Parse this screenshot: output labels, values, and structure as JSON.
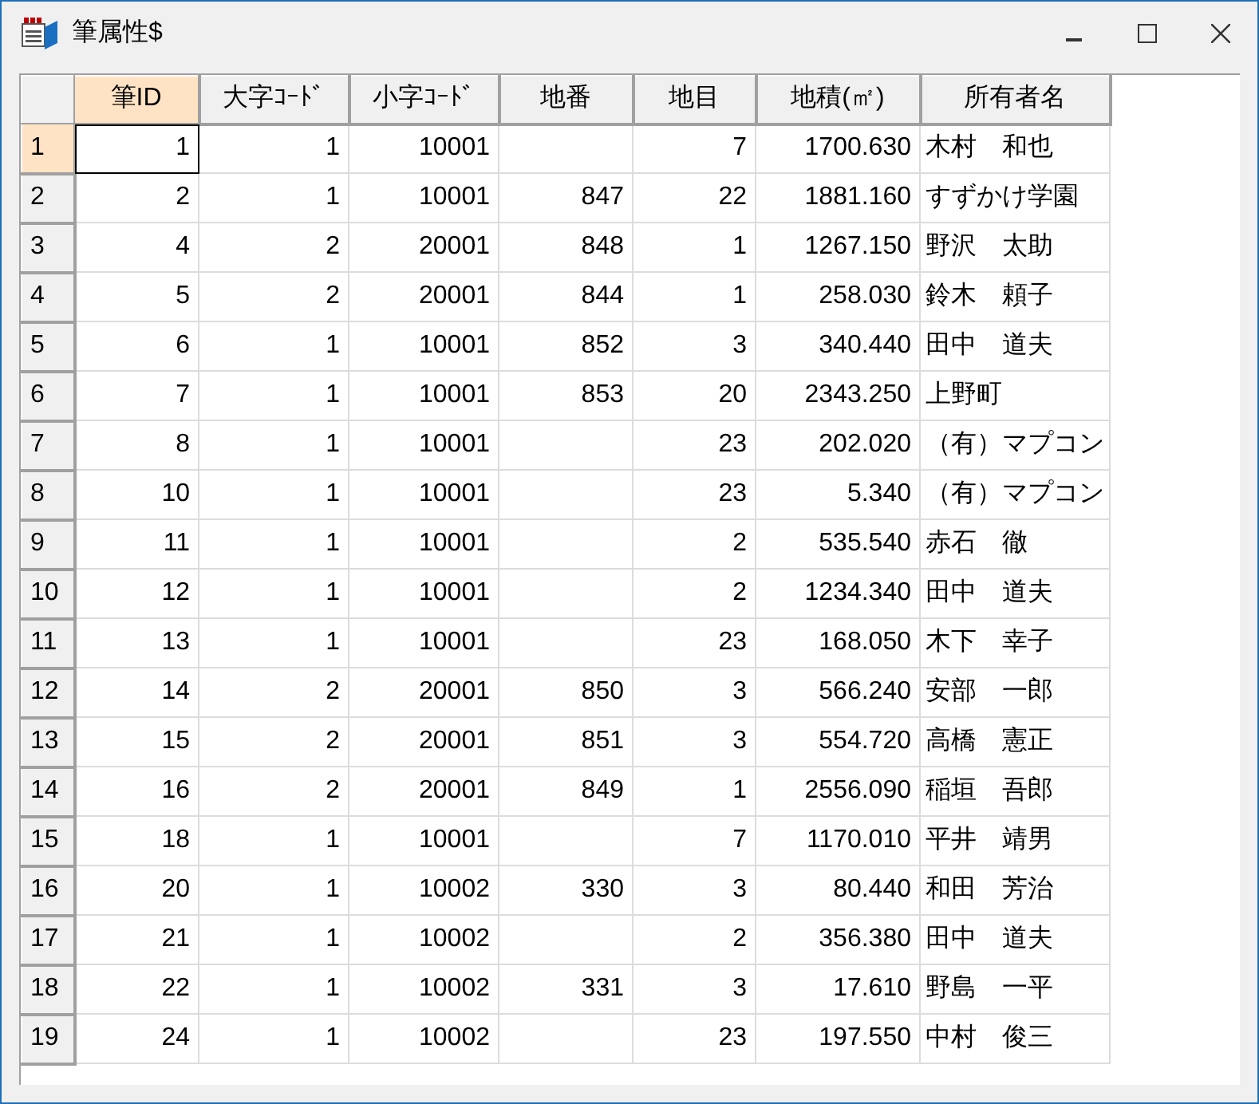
{
  "window": {
    "title": "筆属性$"
  },
  "table": {
    "columns": [
      {
        "label": "筆ID",
        "selected": true
      },
      {
        "label": "大字ｺｰﾄﾞ",
        "selected": false
      },
      {
        "label": "小字ｺｰﾄﾞ",
        "selected": false
      },
      {
        "label": "地番",
        "selected": false
      },
      {
        "label": "地目",
        "selected": false
      },
      {
        "label": "地積(㎡)",
        "selected": false
      },
      {
        "label": "所有者名",
        "selected": false
      }
    ],
    "rows": [
      {
        "number": "1",
        "selected": true,
        "cells": [
          "1",
          "1",
          "10001",
          "",
          "7",
          "1700.630",
          "木村　和也"
        ]
      },
      {
        "number": "2",
        "selected": false,
        "cells": [
          "2",
          "1",
          "10001",
          "847",
          "22",
          "1881.160",
          "すずかけ学園"
        ]
      },
      {
        "number": "3",
        "selected": false,
        "cells": [
          "4",
          "2",
          "20001",
          "848",
          "1",
          "1267.150",
          "野沢　太助"
        ]
      },
      {
        "number": "4",
        "selected": false,
        "cells": [
          "5",
          "2",
          "20001",
          "844",
          "1",
          "258.030",
          "鈴木　頼子"
        ]
      },
      {
        "number": "5",
        "selected": false,
        "cells": [
          "6",
          "1",
          "10001",
          "852",
          "3",
          "340.440",
          "田中　道夫"
        ]
      },
      {
        "number": "6",
        "selected": false,
        "cells": [
          "7",
          "1",
          "10001",
          "853",
          "20",
          "2343.250",
          "上野町"
        ]
      },
      {
        "number": "7",
        "selected": false,
        "cells": [
          "8",
          "1",
          "10001",
          "",
          "23",
          "202.020",
          "（有）マプコン"
        ]
      },
      {
        "number": "8",
        "selected": false,
        "cells": [
          "10",
          "1",
          "10001",
          "",
          "23",
          "5.340",
          "（有）マプコン"
        ]
      },
      {
        "number": "9",
        "selected": false,
        "cells": [
          "11",
          "1",
          "10001",
          "",
          "2",
          "535.540",
          "赤石　徹"
        ]
      },
      {
        "number": "10",
        "selected": false,
        "cells": [
          "12",
          "1",
          "10001",
          "",
          "2",
          "1234.340",
          "田中　道夫"
        ]
      },
      {
        "number": "11",
        "selected": false,
        "cells": [
          "13",
          "1",
          "10001",
          "",
          "23",
          "168.050",
          "木下　幸子"
        ]
      },
      {
        "number": "12",
        "selected": false,
        "cells": [
          "14",
          "2",
          "20001",
          "850",
          "3",
          "566.240",
          "安部　一郎"
        ]
      },
      {
        "number": "13",
        "selected": false,
        "cells": [
          "15",
          "2",
          "20001",
          "851",
          "3",
          "554.720",
          "高橋　憲正"
        ]
      },
      {
        "number": "14",
        "selected": false,
        "cells": [
          "16",
          "2",
          "20001",
          "849",
          "1",
          "2556.090",
          "稲垣　吾郎"
        ]
      },
      {
        "number": "15",
        "selected": false,
        "cells": [
          "18",
          "1",
          "10001",
          "",
          "7",
          "1170.010",
          "平井　靖男"
        ]
      },
      {
        "number": "16",
        "selected": false,
        "cells": [
          "20",
          "1",
          "10002",
          "330",
          "3",
          "80.440",
          "和田　芳治"
        ]
      },
      {
        "number": "17",
        "selected": false,
        "cells": [
          "21",
          "1",
          "10002",
          "",
          "2",
          "356.380",
          "田中　道夫"
        ]
      },
      {
        "number": "18",
        "selected": false,
        "cells": [
          "22",
          "1",
          "10002",
          "331",
          "3",
          "17.610",
          "野島　一平"
        ]
      },
      {
        "number": "19",
        "selected": false,
        "cells": [
          "24",
          "1",
          "10002",
          "",
          "23",
          "197.550",
          "中村　俊三"
        ]
      }
    ]
  }
}
